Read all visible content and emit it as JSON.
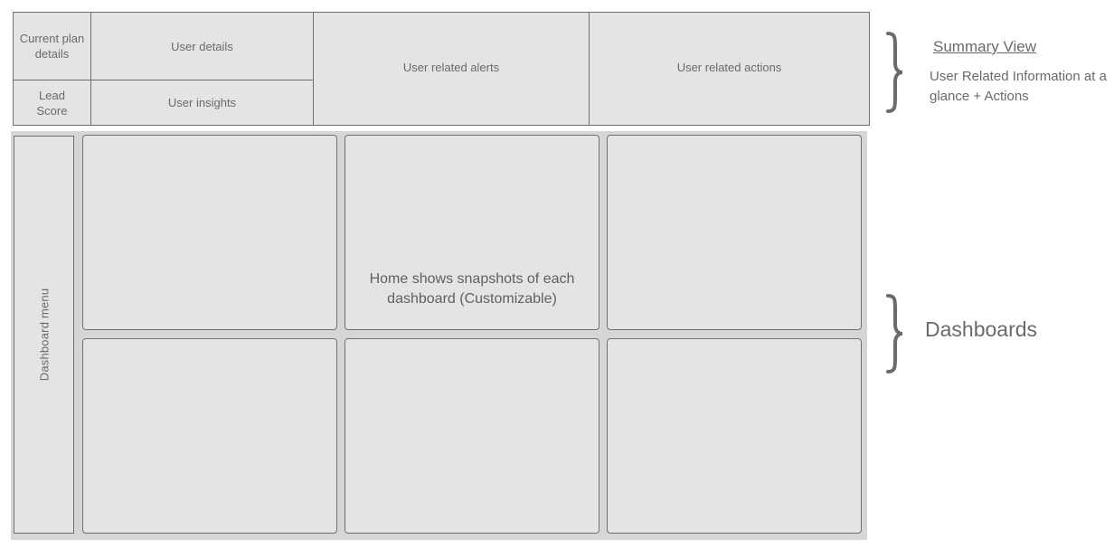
{
  "summary": {
    "current_plan": "Current plan details",
    "user_details": "User details",
    "lead_score": "Lead Score",
    "user_insights": "User insights",
    "user_alerts": "User related alerts",
    "user_actions": "User related actions"
  },
  "dashboard": {
    "menu_label": "Dashboard menu",
    "home_note": "Home shows snapshots of each dashboard (Customizable)"
  },
  "annotations": {
    "summary_title": "Summary View",
    "summary_desc": "User Related Information at a glance + Actions",
    "dashboards": "Dashboards"
  },
  "colors": {
    "panel_fill": "#e4e4e4",
    "area_fill": "#d6d6d6",
    "border": "#6f6f6f",
    "text": "#6a6a6a",
    "brace": "#6b6b6b"
  }
}
